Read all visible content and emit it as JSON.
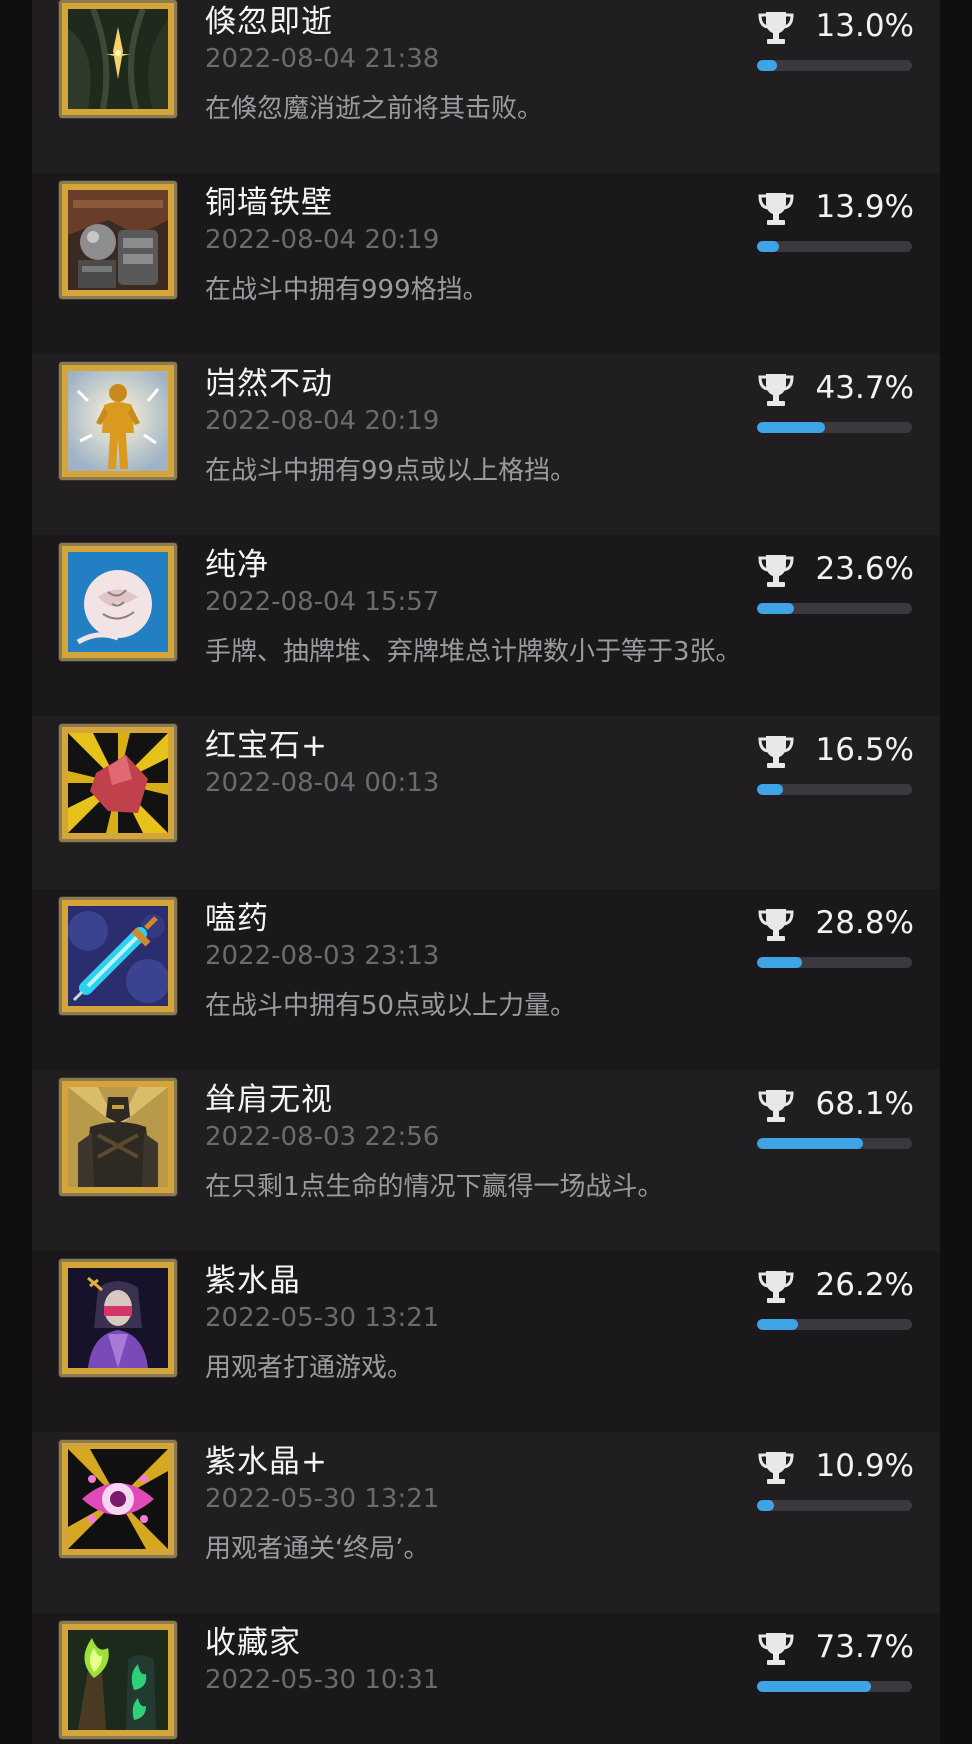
{
  "colors": {
    "background": "#0f0e10",
    "row_odd": "#211e22",
    "row_even": "#1b181c",
    "title": "#f4f4f4",
    "date": "#6c6a6e",
    "description": "#9c9a9e",
    "progress": "#3fa4e6",
    "progress_track": "#3b393d",
    "frame_gold": "#d5a53a"
  },
  "achievements": [
    {
      "title": "倏忽即逝",
      "date": "2022-08-04 21:38",
      "description": "在倏忽魔消逝之前将其击败。",
      "percent_label": "13.0%",
      "percent": 13.0,
      "icon": "shadow-sparkle-icon"
    },
    {
      "title": "铜墙铁壁",
      "date": "2022-08-04 20:19",
      "description": "在战斗中拥有999格挡。",
      "percent_label": "13.9%",
      "percent": 13.9,
      "icon": "armored-fist-icon"
    },
    {
      "title": "岿然不动",
      "date": "2022-08-04 20:19",
      "description": "在战斗中拥有99点或以上格挡。",
      "percent_label": "43.7%",
      "percent": 43.7,
      "icon": "golden-statue-icon"
    },
    {
      "title": "纯净",
      "date": "2022-08-04 15:57",
      "description": "手牌、抽牌堆、弃牌堆总计牌数小于等于3张。",
      "percent_label": "23.6%",
      "percent": 23.6,
      "icon": "white-rose-icon"
    },
    {
      "title": "红宝石+",
      "date": "2022-08-04 00:13",
      "description": "",
      "percent_label": "16.5%",
      "percent": 16.5,
      "icon": "red-gem-icon"
    },
    {
      "title": "嗑药",
      "date": "2022-08-03 23:13",
      "description": "在战斗中拥有50点或以上力量。",
      "percent_label": "28.8%",
      "percent": 28.8,
      "icon": "syringe-icon"
    },
    {
      "title": "耸肩无视",
      "date": "2022-08-03 22:56",
      "description": "在只剩1点生命的情况下赢得一场战斗。",
      "percent_label": "68.1%",
      "percent": 68.1,
      "icon": "dark-knight-icon"
    },
    {
      "title": "紫水晶",
      "date": "2022-05-30 13:21",
      "description": "用观者打通游戏。",
      "percent_label": "26.2%",
      "percent": 26.2,
      "icon": "watcher-portrait-icon"
    },
    {
      "title": "紫水晶+",
      "date": "2022-05-30 13:21",
      "description": "用观者通关‘终局’。",
      "percent_label": "10.9%",
      "percent": 10.9,
      "icon": "purple-eye-icon"
    },
    {
      "title": "收藏家",
      "date": "2022-05-30 10:31",
      "description": "",
      "percent_label": "73.7%",
      "percent": 73.7,
      "icon": "green-flame-icon"
    }
  ]
}
